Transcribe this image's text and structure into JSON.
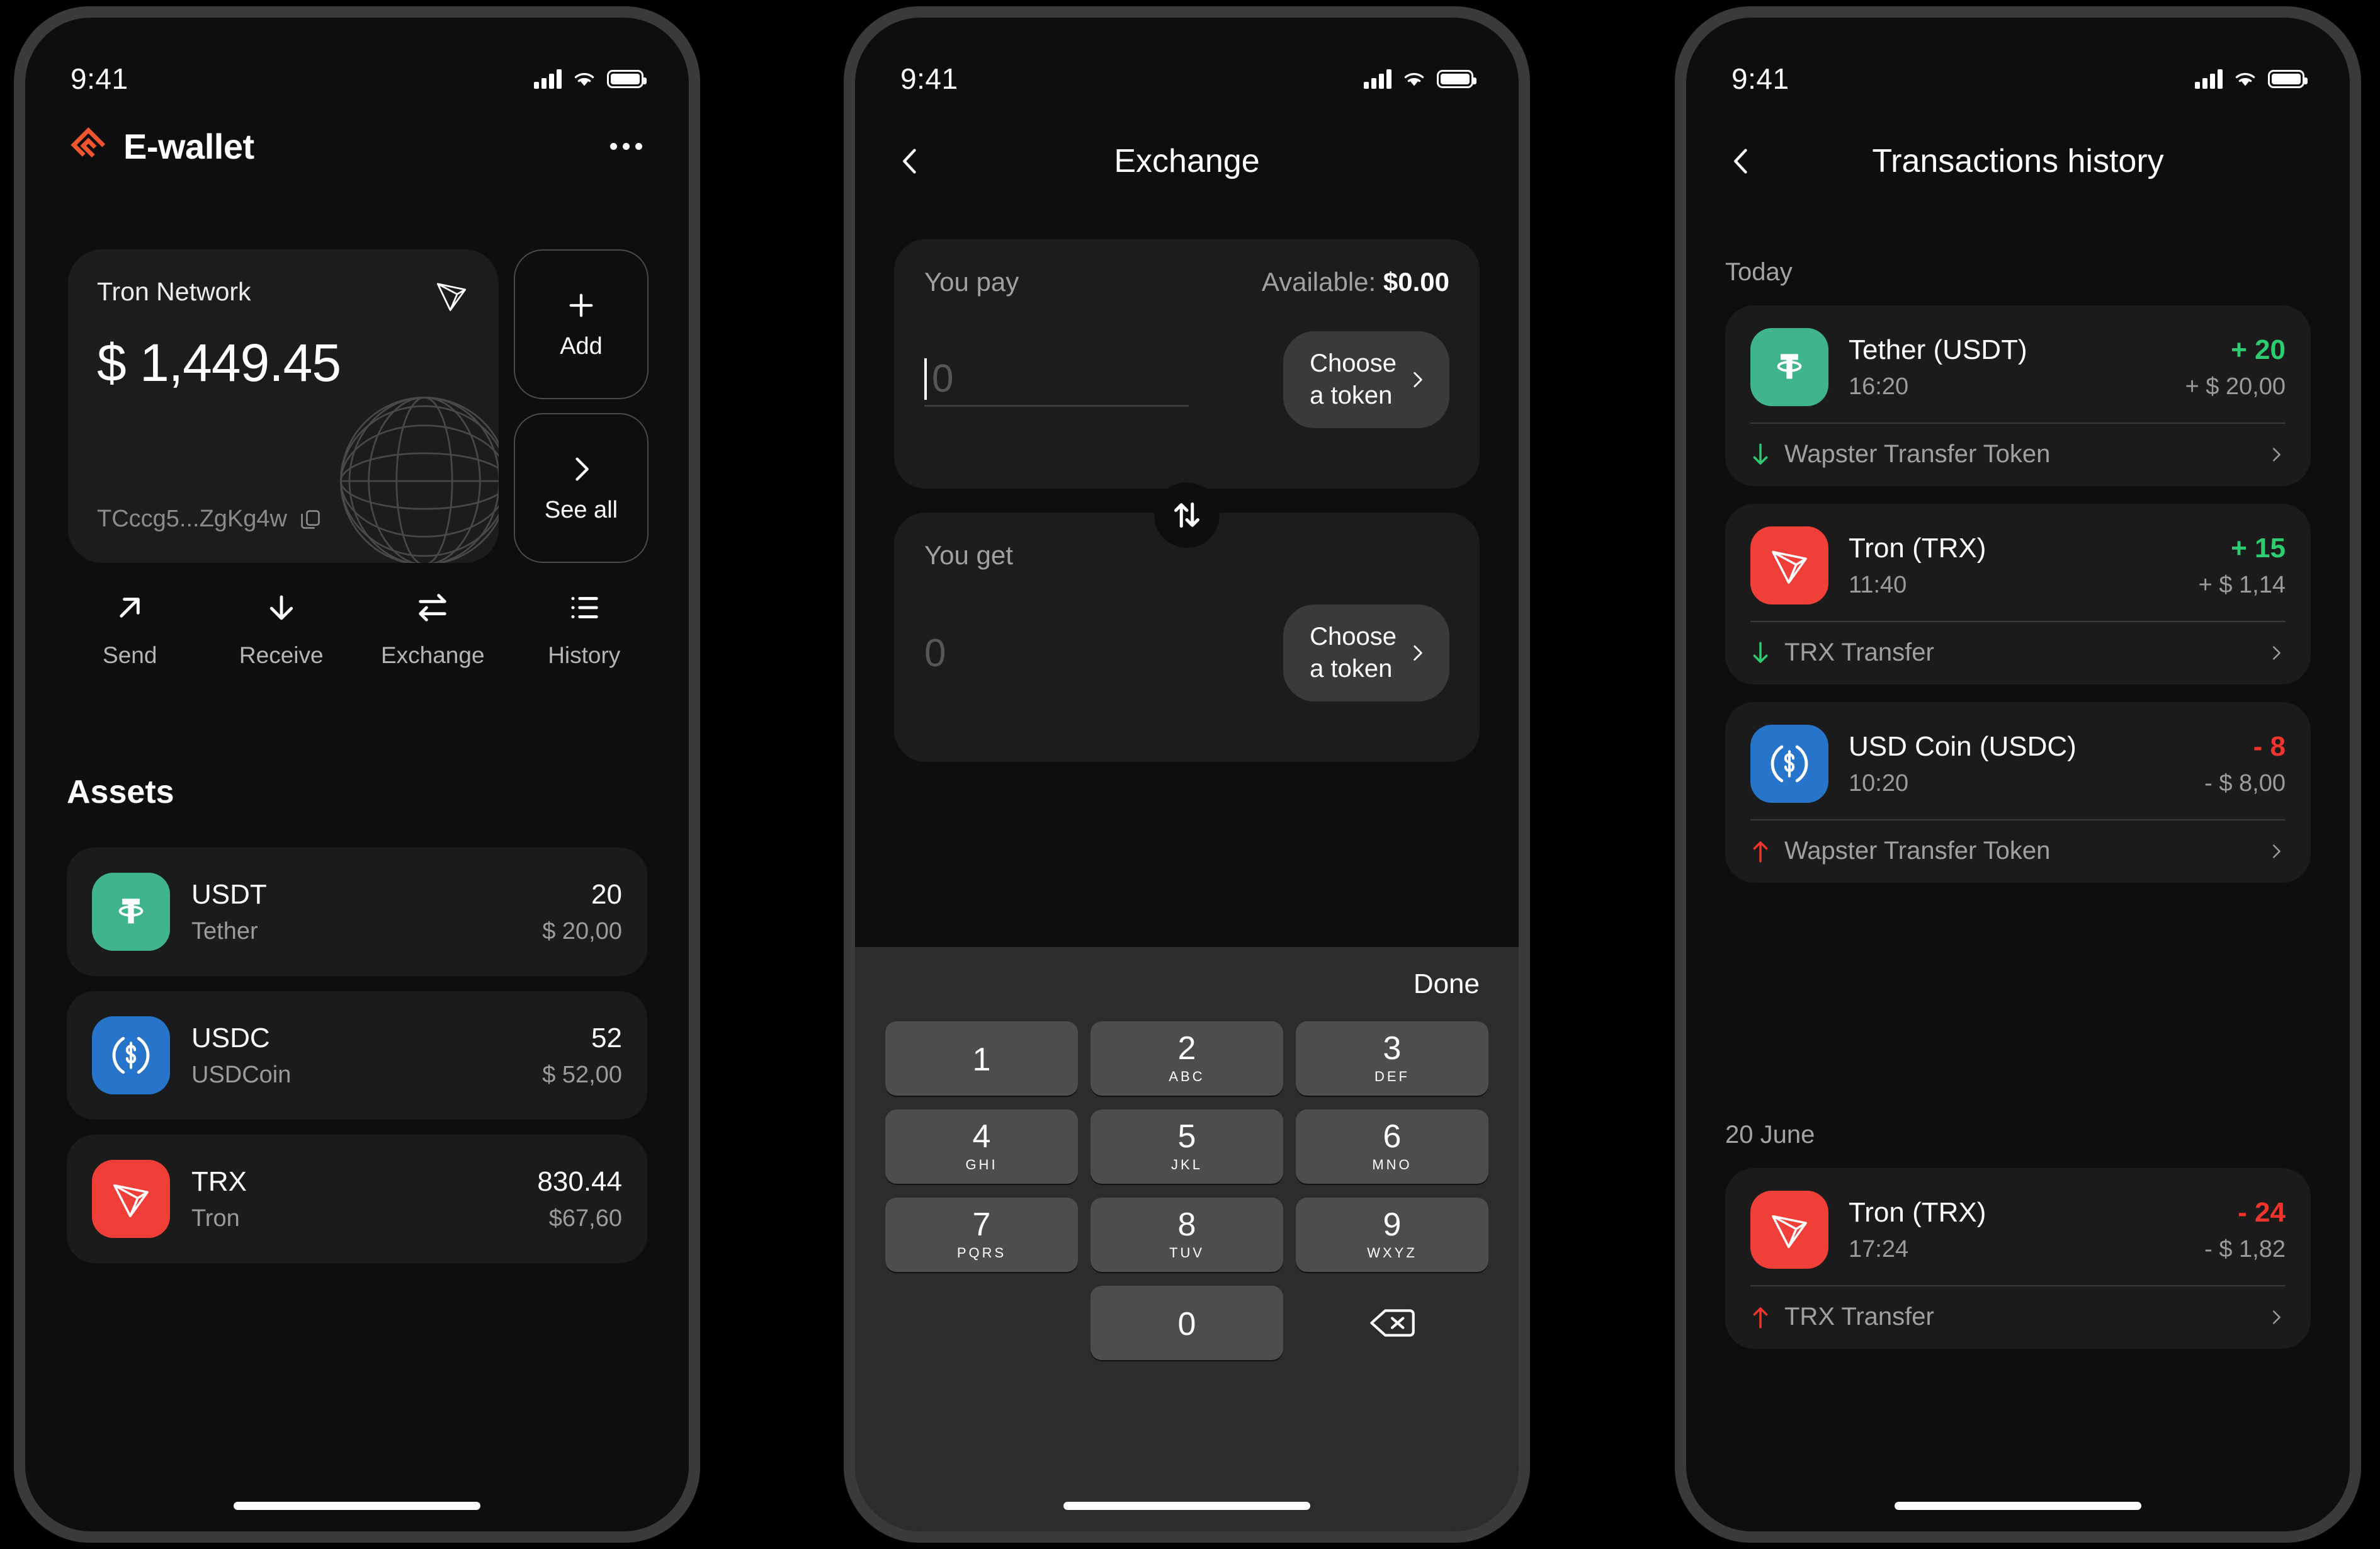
{
  "status_bar": {
    "time": "9:41",
    "signal_icon": "cellular-signal-icon",
    "wifi_icon": "wifi-icon",
    "battery_icon": "battery-icon"
  },
  "colors": {
    "accent_orange": "#f0552f",
    "positive_green": "#2ecc71",
    "negative_red": "#f0342c",
    "usdt_green": "#40b58d",
    "usdc_blue": "#2775ca",
    "trx_red": "#ef3f38",
    "card_bg": "#1b1b1b",
    "screen_bg": "#0e0e0e"
  },
  "wallet": {
    "app_title": "E-wallet",
    "logo_icon": "ewallet-logo-icon",
    "menu_icon": "more-options-icon",
    "balance_card": {
      "network": "Tron Network",
      "network_icon": "tron-logo-icon",
      "amount": "$ 1,449.45",
      "address": "TCccg5...ZgKg4w",
      "copy_icon": "copy-icon",
      "decoration": "wireframe-globe"
    },
    "side_buttons": [
      {
        "label": "Add",
        "icon": "plus-icon"
      },
      {
        "label": "See all",
        "icon": "chevron-right-icon"
      }
    ],
    "actions": [
      {
        "label": "Send",
        "icon": "arrow-up-right-icon"
      },
      {
        "label": "Receive",
        "icon": "arrow-down-icon"
      },
      {
        "label": "Exchange",
        "icon": "swap-horizontal-icon"
      },
      {
        "label": "History",
        "icon": "list-icon"
      }
    ],
    "assets_title": "Assets",
    "assets": [
      {
        "symbol": "USDT",
        "name": "Tether",
        "quantity": "20",
        "usd": "$ 20,00",
        "icon": "tether-icon",
        "color": "#40b58d"
      },
      {
        "symbol": "USDC",
        "name": "USDCoin",
        "quantity": "52",
        "usd": "$ 52,00",
        "icon": "usdc-icon",
        "color": "#2775ca"
      },
      {
        "symbol": "TRX",
        "name": "Tron",
        "quantity": "830.44",
        "usd": "$67,60",
        "icon": "tron-icon",
        "color": "#ef3f38"
      }
    ]
  },
  "exchange": {
    "title": "Exchange",
    "back_icon": "back-chevron-icon",
    "pay": {
      "label": "You pay",
      "available_label": "Available:",
      "available_value": "$0.00",
      "amount_placeholder": "0",
      "amount_value": "",
      "token_button": "Choose\na token",
      "token_button_line1": "Choose",
      "token_button_line2": "a token",
      "token_chevron_icon": "chevron-right-icon"
    },
    "get": {
      "label": "You get",
      "amount_placeholder": "0",
      "amount_value": "",
      "token_button_line1": "Choose",
      "token_button_line2": "a token",
      "token_chevron_icon": "chevron-right-icon"
    },
    "swap_icon": "swap-vertical-icon",
    "keyboard": {
      "done_label": "Done",
      "keys": [
        {
          "num": "1",
          "sub": ""
        },
        {
          "num": "2",
          "sub": "ABC"
        },
        {
          "num": "3",
          "sub": "DEF"
        },
        {
          "num": "4",
          "sub": "GHI"
        },
        {
          "num": "5",
          "sub": "JKL"
        },
        {
          "num": "6",
          "sub": "MNO"
        },
        {
          "num": "7",
          "sub": "PQRS"
        },
        {
          "num": "8",
          "sub": "TUV"
        },
        {
          "num": "9",
          "sub": "WXYZ"
        },
        {
          "num": "0",
          "sub": ""
        }
      ],
      "backspace_icon": "backspace-icon"
    }
  },
  "history": {
    "title": "Transactions history",
    "back_icon": "back-chevron-icon",
    "sections": [
      {
        "date": "Today",
        "transactions": [
          {
            "coin": "Tether (USDT)",
            "time": "16:20",
            "amount": "+ 20",
            "usd": "+ $ 20,00",
            "direction": "in",
            "description": "Wapster Transfer Token",
            "icon": "tether-icon",
            "color": "#40b58d",
            "amount_color": "#2ecc71",
            "arrow_icon": "arrow-down-icon",
            "chevron_icon": "chevron-right-icon"
          },
          {
            "coin": "Tron (TRX)",
            "time": "11:40",
            "amount": "+ 15",
            "usd": "+ $ 1,14",
            "direction": "in",
            "description": "TRX Transfer",
            "icon": "tron-icon",
            "color": "#ef3f38",
            "amount_color": "#2ecc71",
            "arrow_icon": "arrow-down-icon",
            "chevron_icon": "chevron-right-icon"
          },
          {
            "coin": "USD Coin (USDC)",
            "time": "10:20",
            "amount": "- 8",
            "usd": "- $ 8,00",
            "direction": "out",
            "description": "Wapster Transfer Token",
            "icon": "usdc-icon",
            "color": "#2775ca",
            "amount_color": "#f0342c",
            "arrow_icon": "arrow-up-icon",
            "chevron_icon": "chevron-right-icon"
          }
        ]
      },
      {
        "date": "20 June",
        "transactions": [
          {
            "coin": "Tron (TRX)",
            "time": "17:24",
            "amount": "- 24",
            "usd": "- $ 1,82",
            "direction": "out",
            "description": "TRX Transfer",
            "icon": "tron-icon",
            "color": "#ef3f38",
            "amount_color": "#f0342c",
            "arrow_icon": "arrow-up-icon",
            "chevron_icon": "chevron-right-icon"
          }
        ]
      }
    ]
  }
}
